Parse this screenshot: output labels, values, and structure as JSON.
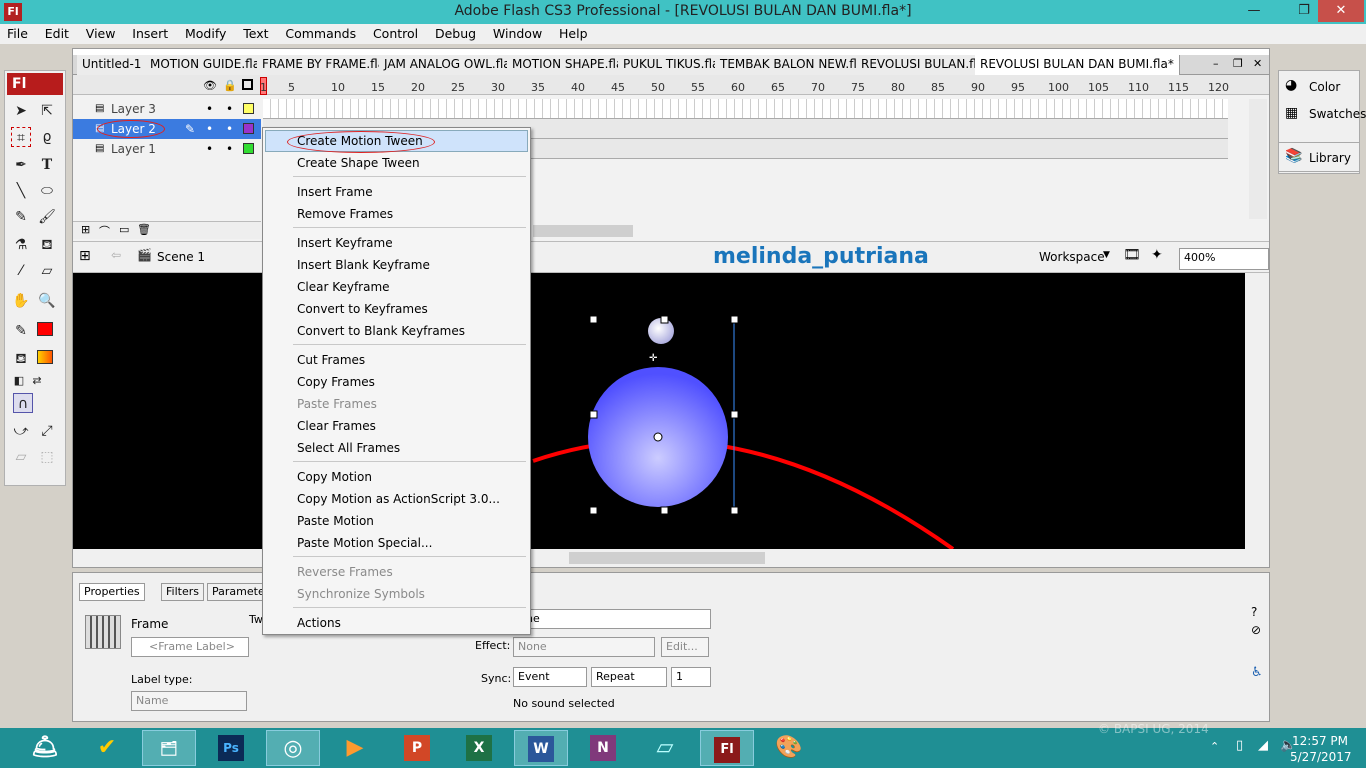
{
  "window": {
    "title": "Adobe Flash CS3 Professional - [REVOLUSI BULAN DAN BUMI.fla*]",
    "app_icon": "Fl",
    "min": "—",
    "max": "❐",
    "close": "✕"
  },
  "menu": [
    "File",
    "Edit",
    "View",
    "Insert",
    "Modify",
    "Text",
    "Commands",
    "Control",
    "Debug",
    "Window",
    "Help"
  ],
  "tabs": [
    "Untitled-1",
    "MOTION GUIDE.fla",
    "FRAME BY FRAME.fla",
    "JAM ANALOG OWL.fla",
    "MOTION SHAPE.fla",
    "PUKUL TIKUS.fla",
    "TEMBAK BALON NEW.fla",
    "REVOLUSI BULAN.fla",
    "REVOLUSI BULAN DAN BUMI.fla*"
  ],
  "timeline": {
    "ruler": [
      "1",
      "5",
      "10",
      "15",
      "20",
      "25",
      "30",
      "35",
      "40",
      "45",
      "50",
      "55",
      "60",
      "65",
      "70",
      "75",
      "80",
      "85",
      "90",
      "95",
      "100",
      "105",
      "110",
      "115",
      "120"
    ],
    "layers": [
      {
        "name": "Layer 3",
        "color": "#ffff66"
      },
      {
        "name": "Layer 2",
        "color": "#9933cc"
      },
      {
        "name": "Layer 1",
        "color": "#33dd33"
      }
    ]
  },
  "editbar": {
    "scene": "Scene 1",
    "watermark": "melinda_putriana",
    "workspace": "Workspace",
    "zoom": "400%"
  },
  "context_menu": {
    "groups": [
      [
        "Create Motion Tween",
        "Create Shape Tween"
      ],
      [
        "Insert Frame",
        "Remove Frames"
      ],
      [
        "Insert Keyframe",
        "Insert Blank Keyframe",
        "Clear Keyframe",
        "Convert to Keyframes",
        "Convert to Blank Keyframes"
      ],
      [
        "Cut Frames",
        "Copy Frames",
        "Paste Frames",
        "Clear Frames",
        "Select All Frames"
      ],
      [
        "Copy Motion",
        "Copy Motion as ActionScript 3.0...",
        "Paste Motion",
        "Paste Motion Special..."
      ],
      [
        "Reverse Frames",
        "Synchronize Symbols"
      ],
      [
        "Actions"
      ]
    ],
    "disabled": [
      "Paste Frames",
      "Reverse Frames",
      "Synchronize Symbols"
    ],
    "highlighted": "Create Motion Tween"
  },
  "properties": {
    "tabs": [
      "Properties",
      "Filters",
      "Parameters"
    ],
    "frame_label": "Frame",
    "frame_placeholder": "<Frame Label>",
    "label_type_caption": "Label type:",
    "label_type_value": "Name",
    "tween_caption": "Tw",
    "sound_value": "ne",
    "effect_caption": "Effect:",
    "effect_value": "None",
    "edit_button": "Edit...",
    "sync_caption": "Sync:",
    "sync_value": "Event",
    "repeat_value": "Repeat",
    "repeat_count": "1",
    "status": "No sound selected"
  },
  "right_panels": {
    "color": "Color",
    "swatches": "Swatches",
    "library": "Library"
  },
  "taskbar": {
    "apps": [
      "Help",
      "Norton",
      "Explorer",
      "Ps",
      "Chrome",
      "Media",
      "P",
      "X",
      "W",
      "N",
      "Notes",
      "Fl",
      "Paint"
    ],
    "watermark": "© BAPSI UG, 2014",
    "time": "12:57 PM",
    "date": "5/27/2017"
  },
  "colors": {
    "accent": "#3b7be0",
    "stage": "#000000",
    "earth": "#6b6bff",
    "orbit": "#ff0000",
    "taskbar": "#1f8f94"
  }
}
